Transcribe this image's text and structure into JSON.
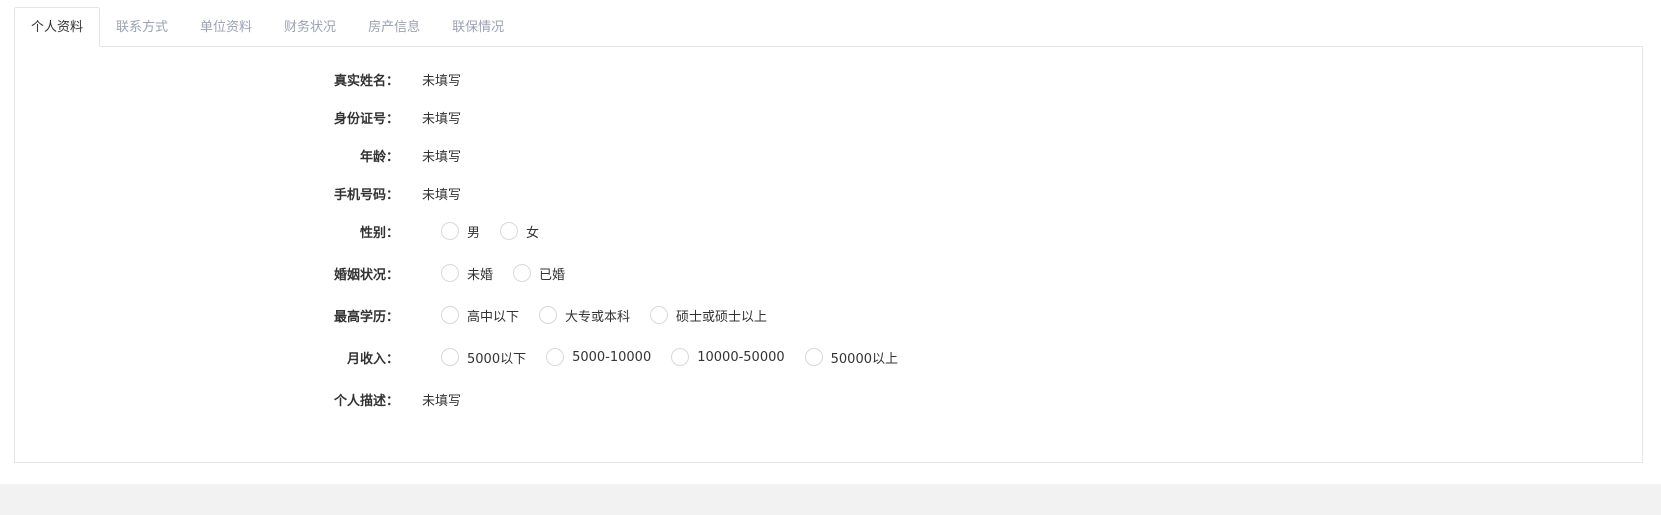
{
  "tabs": [
    {
      "label": "个人资料",
      "active": true
    },
    {
      "label": "联系方式",
      "active": false
    },
    {
      "label": "单位资料",
      "active": false
    },
    {
      "label": "财务状况",
      "active": false
    },
    {
      "label": "房产信息",
      "active": false
    },
    {
      "label": "联保情况",
      "active": false
    }
  ],
  "form": {
    "real_name": {
      "label": "真实姓名：",
      "value": "未填写"
    },
    "id_number": {
      "label": "身份证号：",
      "value": "未填写"
    },
    "age": {
      "label": "年龄：",
      "value": "未填写"
    },
    "phone": {
      "label": "手机号码：",
      "value": "未填写"
    },
    "gender": {
      "label": "性别：",
      "options": [
        "男",
        "女"
      ]
    },
    "marital": {
      "label": "婚姻状况：",
      "options": [
        "未婚",
        "已婚"
      ]
    },
    "education": {
      "label": "最高学历：",
      "options": [
        "高中以下",
        "大专或本科",
        "硕士或硕士以上"
      ]
    },
    "income": {
      "label": "月收入：",
      "options": [
        "5000以下",
        "5000-10000",
        "10000-50000",
        "50000以上"
      ]
    },
    "description": {
      "label": "个人描述：",
      "value": "未填写"
    }
  },
  "colors": {
    "accent_text": "#333333",
    "inactive_tab": "#9aa3b4",
    "border": "#e6e6e6",
    "footer_band": "#f2f2f2"
  }
}
